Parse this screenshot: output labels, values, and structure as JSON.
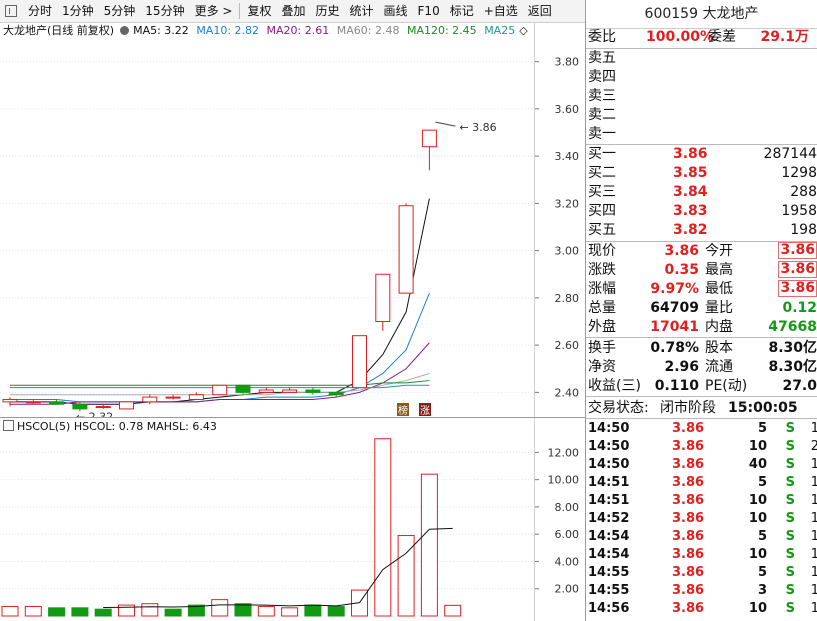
{
  "toolbar": {
    "items": [
      "分时",
      "1分钟",
      "5分钟",
      "15分钟",
      "更多 >",
      "复权",
      "叠加",
      "历史",
      "统计",
      "画线",
      "F10",
      "标记",
      "+自选",
      "返回"
    ]
  },
  "chart_header": {
    "name": "大龙地产(日线 前复权)",
    "ma5": "MA5: 3.22",
    "ma10": "MA10: 2.82",
    "ma20": "MA20: 2.61",
    "ma60": "MA60: 2.48",
    "ma120": "MA120: 2.45",
    "ma250": "MA25",
    "colors": {
      "ma5": "#111111",
      "ma10": "#1a7fd6",
      "ma20": "#8a1a8a",
      "ma60": "#aaaaaa",
      "ma120": "#1a8a2a",
      "ma250": "#1a9a9a"
    }
  },
  "price_annotations": {
    "high": "3.86",
    "low": "2.32"
  },
  "badges": {
    "bang": "榜",
    "zhang": "涨"
  },
  "volume_header": {
    "name": "HSCOL(5)",
    "hscol": "HSCOL: 0.78",
    "mahsl": "MAHSL: 6.43"
  },
  "chart_data": [
    {
      "type": "candlestick",
      "ylim": [
        2.3,
        3.9
      ],
      "yticks": [
        "3.80",
        "3.60",
        "3.40",
        "3.20",
        "3.00",
        "2.80",
        "2.60",
        "2.40"
      ],
      "candles": [
        {
          "o": 2.36,
          "h": 2.38,
          "l": 2.34,
          "c": 2.37
        },
        {
          "o": 2.36,
          "h": 2.37,
          "l": 2.35,
          "c": 2.36
        },
        {
          "o": 2.36,
          "h": 2.37,
          "l": 2.35,
          "c": 2.35
        },
        {
          "o": 2.35,
          "h": 2.36,
          "l": 2.32,
          "c": 2.33
        },
        {
          "o": 2.34,
          "h": 2.35,
          "l": 2.33,
          "c": 2.34
        },
        {
          "o": 2.33,
          "h": 2.36,
          "l": 2.33,
          "c": 2.36
        },
        {
          "o": 2.36,
          "h": 2.39,
          "l": 2.35,
          "c": 2.38
        },
        {
          "o": 2.38,
          "h": 2.39,
          "l": 2.37,
          "c": 2.38
        },
        {
          "o": 2.37,
          "h": 2.4,
          "l": 2.37,
          "c": 2.39
        },
        {
          "o": 2.39,
          "h": 2.43,
          "l": 2.39,
          "c": 2.43
        },
        {
          "o": 2.43,
          "h": 2.43,
          "l": 2.39,
          "c": 2.4
        },
        {
          "o": 2.4,
          "h": 2.42,
          "l": 2.4,
          "c": 2.41
        },
        {
          "o": 2.4,
          "h": 2.42,
          "l": 2.4,
          "c": 2.41
        },
        {
          "o": 2.41,
          "h": 2.42,
          "l": 2.39,
          "c": 2.4
        },
        {
          "o": 2.4,
          "h": 2.4,
          "l": 2.38,
          "c": 2.39
        },
        {
          "o": 2.42,
          "h": 2.64,
          "l": 2.42,
          "c": 2.64
        },
        {
          "o": 2.7,
          "h": 2.9,
          "l": 2.66,
          "c": 2.9
        },
        {
          "o": 2.82,
          "h": 3.2,
          "l": 2.82,
          "c": 3.19
        },
        {
          "o": 3.44,
          "h": 3.51,
          "l": 3.34,
          "c": 3.51
        }
      ],
      "ma_lines": {
        "ma5": [
          2.36,
          2.36,
          2.36,
          2.35,
          2.35,
          2.35,
          2.36,
          2.36,
          2.37,
          2.38,
          2.39,
          2.4,
          2.4,
          2.4,
          2.4,
          2.45,
          2.56,
          2.74,
          3.22
        ],
        "ma10": [
          2.37,
          2.37,
          2.37,
          2.36,
          2.36,
          2.36,
          2.36,
          2.36,
          2.36,
          2.37,
          2.37,
          2.38,
          2.38,
          2.38,
          2.39,
          2.42,
          2.48,
          2.58,
          2.82
        ],
        "ma20": [
          2.35,
          2.35,
          2.35,
          2.36,
          2.36,
          2.36,
          2.36,
          2.36,
          2.36,
          2.37,
          2.37,
          2.37,
          2.37,
          2.37,
          2.38,
          2.4,
          2.44,
          2.5,
          2.61
        ],
        "ma60": [
          2.39,
          2.39,
          2.39,
          2.39,
          2.39,
          2.39,
          2.39,
          2.39,
          2.39,
          2.39,
          2.39,
          2.39,
          2.4,
          2.4,
          2.4,
          2.41,
          2.43,
          2.45,
          2.48
        ],
        "ma120": [
          2.43,
          2.43,
          2.43,
          2.43,
          2.43,
          2.43,
          2.43,
          2.43,
          2.43,
          2.43,
          2.43,
          2.43,
          2.43,
          2.43,
          2.43,
          2.43,
          2.44,
          2.44,
          2.45
        ],
        "ma250": [
          2.42,
          2.42,
          2.42,
          2.42,
          2.42,
          2.42,
          2.42,
          2.42,
          2.42,
          2.42,
          2.42,
          2.42,
          2.42,
          2.42,
          2.42,
          2.42,
          2.42,
          2.43,
          2.43
        ]
      }
    },
    {
      "type": "bar",
      "ylim": [
        0,
        13.2
      ],
      "yticks": [
        "12.00",
        "10.00",
        "8.00",
        "6.00",
        "4.00",
        "2.00"
      ],
      "values": [
        0.7,
        0.7,
        0.6,
        0.6,
        0.5,
        0.8,
        0.9,
        0.5,
        0.8,
        1.2,
        0.9,
        0.7,
        0.6,
        0.8,
        0.7,
        1.9,
        13.0,
        5.9,
        10.4,
        0.78
      ],
      "up": [
        true,
        true,
        false,
        false,
        false,
        true,
        true,
        false,
        false,
        true,
        false,
        true,
        true,
        false,
        false,
        true,
        true,
        true,
        true,
        true
      ],
      "mahsl": [
        null,
        null,
        null,
        null,
        0.62,
        0.64,
        0.68,
        0.66,
        0.7,
        0.82,
        0.82,
        0.8,
        0.74,
        0.8,
        0.74,
        0.98,
        3.4,
        4.6,
        6.36,
        6.43
      ]
    }
  ],
  "quote": {
    "title": "600159 大龙地产",
    "weibi_label": "委比",
    "weibi_value": "100.00%",
    "weicha_label": "委差",
    "weicha_value": "29.1万",
    "sell": [
      {
        "label": "卖五"
      },
      {
        "label": "卖四"
      },
      {
        "label": "卖三"
      },
      {
        "label": "卖二"
      },
      {
        "label": "卖一"
      }
    ],
    "buy": [
      {
        "label": "买一",
        "price": "3.86",
        "vol": "287144"
      },
      {
        "label": "买二",
        "price": "3.85",
        "vol": "1298"
      },
      {
        "label": "买三",
        "price": "3.84",
        "vol": "288"
      },
      {
        "label": "买四",
        "price": "3.83",
        "vol": "1958"
      },
      {
        "label": "买五",
        "price": "3.82",
        "vol": "198"
      }
    ],
    "stats": [
      {
        "l1": "现价",
        "v1": "3.86",
        "l2": "今开",
        "v2": "3.86"
      },
      {
        "l1": "涨跌",
        "v1": "0.35",
        "l2": "最高",
        "v2": "3.86"
      },
      {
        "l1": "涨幅",
        "v1": "9.97%",
        "l2": "最低",
        "v2": "3.86"
      },
      {
        "l1": "总量",
        "v1": "64709",
        "l2": "量比",
        "v2": "0.12"
      },
      {
        "l1": "外盘",
        "v1": "17041",
        "l2": "内盘",
        "v2": "47668"
      }
    ],
    "stats2": [
      {
        "l1": "换手",
        "v1": "0.78%",
        "l2": "股本",
        "v2": "8.30亿"
      },
      {
        "l1": "净资",
        "v1": "2.96",
        "l2": "流通",
        "v2": "8.30亿"
      },
      {
        "l1": "收益(三)",
        "v1": "0.110",
        "l2": "PE(动)",
        "v2": "27.0"
      }
    ],
    "status_label": "交易状态:",
    "status_value": "闭市阶段",
    "status_time": "15:00:05"
  },
  "ticks": [
    {
      "t": "14:50",
      "p": "3.86",
      "v": "5",
      "s": "S",
      "n": "1"
    },
    {
      "t": "14:50",
      "p": "3.86",
      "v": "10",
      "s": "S",
      "n": "2"
    },
    {
      "t": "14:50",
      "p": "3.86",
      "v": "40",
      "s": "S",
      "n": "1"
    },
    {
      "t": "14:51",
      "p": "3.86",
      "v": "5",
      "s": "S",
      "n": "1"
    },
    {
      "t": "14:51",
      "p": "3.86",
      "v": "10",
      "s": "S",
      "n": "1"
    },
    {
      "t": "14:52",
      "p": "3.86",
      "v": "10",
      "s": "S",
      "n": "1"
    },
    {
      "t": "14:54",
      "p": "3.86",
      "v": "5",
      "s": "S",
      "n": "1"
    },
    {
      "t": "14:54",
      "p": "3.86",
      "v": "10",
      "s": "S",
      "n": "1"
    },
    {
      "t": "14:55",
      "p": "3.86",
      "v": "5",
      "s": "S",
      "n": "1"
    },
    {
      "t": "14:55",
      "p": "3.86",
      "v": "3",
      "s": "S",
      "n": "1"
    },
    {
      "t": "14:56",
      "p": "3.86",
      "v": "10",
      "s": "S",
      "n": "1"
    }
  ]
}
